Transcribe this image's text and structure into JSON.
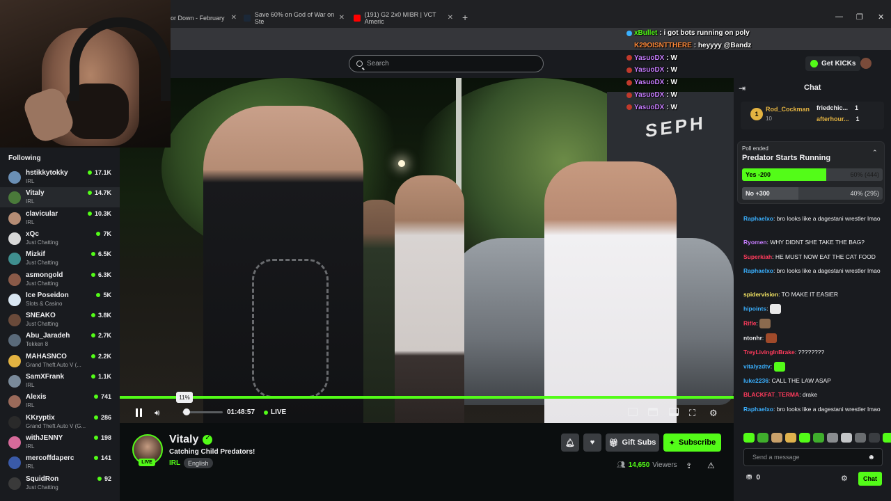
{
  "browser": {
    "tabs": [
      {
        "title": "or Down - February",
        "favicon_color": "#3a3d41"
      },
      {
        "title": "Save 60% on God of War on Ste",
        "favicon_color": "#1b2838"
      },
      {
        "title": "(191) G2 2x0 MIBR | VCT Americ",
        "favicon_color": "#ff0000"
      }
    ],
    "new_tab": "+",
    "win_min": "—",
    "win_max": "❐",
    "win_close": "✕"
  },
  "header": {
    "search_placeholder": "Search",
    "get_kicks": "Get KICKs"
  },
  "sidebar": {
    "title": "Following",
    "channels": [
      {
        "name": "hstikkytokky",
        "category": "IRL",
        "viewers": "17.1K",
        "color": "#6a8fb5"
      },
      {
        "name": "Vitaly",
        "category": "IRL",
        "viewers": "14.7K",
        "color": "#4a7a3a",
        "active": true
      },
      {
        "name": "clavicular",
        "category": "IRL",
        "viewers": "10.3K",
        "color": "#b58c74"
      },
      {
        "name": "xQc",
        "category": "Just Chatting",
        "viewers": "7K",
        "color": "#d8d8d8"
      },
      {
        "name": "Mizkif",
        "category": "Just Chatting",
        "viewers": "6.5K",
        "color": "#3f8f8f"
      },
      {
        "name": "asmongold",
        "category": "Just Chatting",
        "viewers": "6.3K",
        "color": "#8a5a48"
      },
      {
        "name": "Ice Poseidon",
        "category": "Slots & Casino",
        "viewers": "5K",
        "color": "#d9e6f2"
      },
      {
        "name": "SNEAKO",
        "category": "Just Chatting",
        "viewers": "3.8K",
        "color": "#6a4a3a"
      },
      {
        "name": "Abu_Jaradeh",
        "category": "Tekken 8",
        "viewers": "2.7K",
        "color": "#5a6a7a"
      },
      {
        "name": "MAHASNCO",
        "category": "Grand Theft Auto V (...",
        "viewers": "2.2K",
        "color": "#e3b341"
      },
      {
        "name": "SamXFrank",
        "category": "IRL",
        "viewers": "1.1K",
        "color": "#7a8a9a"
      },
      {
        "name": "Alexis",
        "category": "IRL",
        "viewers": "741",
        "color": "#9a6a5a"
      },
      {
        "name": "KKryptix",
        "category": "Grand Theft Auto V (G...",
        "viewers": "286",
        "color": "#2a2a2a"
      },
      {
        "name": "withJENNY",
        "category": "IRL",
        "viewers": "198",
        "color": "#d66a9a"
      },
      {
        "name": "mercoffdaperc",
        "category": "IRL",
        "viewers": "141",
        "color": "#3a5aa8"
      },
      {
        "name": "SquidRon",
        "category": "Just Chatting",
        "viewers": "92",
        "color": "#3a3a3a"
      }
    ]
  },
  "video": {
    "sign_text": "SEPH",
    "volume_tooltip": "11%",
    "volume_fraction": 0.11,
    "time": "01:48:57",
    "live_label": "LIVE"
  },
  "stream": {
    "streamer": "Vitaly",
    "title": "Catching Child Predators!",
    "category": "IRL",
    "tag": "English",
    "live_badge": "LIVE",
    "viewers_count": "14,650",
    "viewers_label": "Viewers",
    "gift_subs": "Gift Subs",
    "subscribe": "Subscribe"
  },
  "overlay_chat": [
    {
      "user": "xBullet",
      "text": ": i got bots running on poly",
      "color": "#53fc18",
      "badge": "#3ab0ff"
    },
    {
      "user": "K29OISNTTHERE",
      "text": ": heyyyy @Bandz",
      "color": "#ff8a3a",
      "badge": ""
    },
    {
      "user": "YasuoDX",
      "text": ": W",
      "color": "#c77dff",
      "badge": "#c0392b"
    },
    {
      "user": "YasuoDX",
      "text": ": W",
      "color": "#c77dff",
      "badge": "#c0392b"
    },
    {
      "user": "YasuoDX",
      "text": ": W",
      "color": "#c77dff",
      "badge": "#c0392b"
    },
    {
      "user": "YasuoDX",
      "text": ": W",
      "color": "#c77dff",
      "badge": "#c0392b"
    },
    {
      "user": "YasuoDX",
      "text": ": W",
      "color": "#c77dff",
      "badge": "#c0392b"
    }
  ],
  "chat": {
    "title": "Chat",
    "leaderboard": {
      "rank": "1",
      "top_user": "Rod_Cockman",
      "top_count": "10",
      "others": [
        {
          "name": "friedchic...",
          "count": "1"
        },
        {
          "name": "afterhour...",
          "count": "1"
        }
      ]
    },
    "poll": {
      "status": "Poll ended",
      "title": "Predator Starts Running",
      "options": [
        {
          "label": "Yes -200",
          "percent": "60% (444)",
          "fraction": 0.6
        },
        {
          "label": "No +300",
          "percent": "40% (295)",
          "fraction": 0.4
        }
      ]
    },
    "messages": [
      {
        "user": "Raphaelxo",
        "text": ": bro looks like a dagestani wrestler lmao",
        "color": "#3ab0ff"
      },
      {
        "user": "Ryomen",
        "text": ": WHY DIDNT SHE TAKE THE BAG?",
        "color": "#c77dff"
      },
      {
        "user": "Superkiah",
        "text": ": HE MUST NOW EAT THE CAT FOOD",
        "color": "#ff3b5c"
      },
      {
        "user": "Raphaelxo",
        "text": ": bro looks like a dagestani wrestler lmao",
        "color": "#3ab0ff"
      },
      {
        "user": "spidervision",
        "text": ": TO MAKE IT EASIER",
        "color": "#f5e663"
      },
      {
        "user": "hipoints",
        "text": ":",
        "color": "#3ab0ff"
      },
      {
        "user": "Rifle",
        "text": ":",
        "color": "#ff3b5c"
      },
      {
        "user": "ntonhr",
        "text": ":",
        "color": "#efeff1"
      },
      {
        "user": "TreyLivingInBrake",
        "text": ": ????????",
        "color": "#ff3b5c"
      },
      {
        "user": "vitalyzdtv",
        "text": ":",
        "color": "#3ab0ff"
      },
      {
        "user": "luke2236",
        "text": ": CALL THE LAW ASAP",
        "color": "#3ab0ff"
      },
      {
        "user": "BLACKFAT_TERMA",
        "text": ": drake",
        "color": "#ff3b5c"
      },
      {
        "user": "Raphaelxo",
        "text": ": bro looks like a dagestani wrestler lmao",
        "color": "#3ab0ff"
      }
    ],
    "input_placeholder": "Send a message",
    "points": "0",
    "send": "Chat"
  }
}
